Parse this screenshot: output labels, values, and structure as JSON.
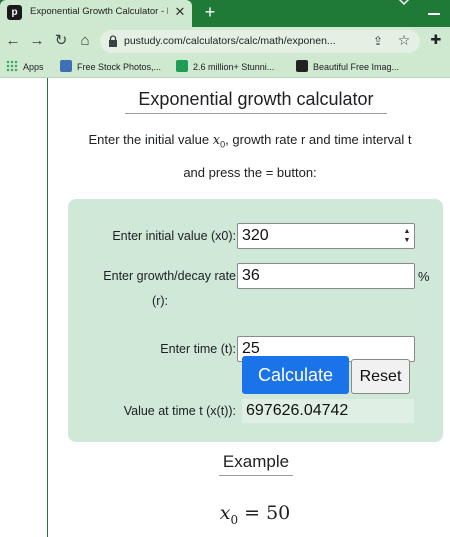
{
  "browser": {
    "tab_title": "Exponential Growth Calculator - F",
    "tab_favicon_letter": "p",
    "newtab_label": "+",
    "url": "pustudy.com/calculators/calc/math/exponen...",
    "bookmarks": [
      {
        "label": "Apps",
        "icon": "apps-grid-icon"
      },
      {
        "label": "Free Stock Photos,...",
        "icon": "photo-site-icon"
      },
      {
        "label": "2.6 million+ Stunni...",
        "icon": "px-site-icon"
      },
      {
        "label": "Beautiful Free Imag...",
        "icon": "image-site-icon"
      }
    ],
    "accent_color": "#1f7a38",
    "chrome_color": "#cfe8d0"
  },
  "page": {
    "title": "Exponential growth calculator",
    "intro_before": "Enter the initial value ",
    "intro_var": "x",
    "intro_sub": "0",
    "intro_after": ", growth rate r and time interval t",
    "intro_line2": "and press the = button:",
    "form": {
      "initial_label": "Enter initial value (x0):",
      "initial_value": "320",
      "rate_label": "Enter growth/decay rate",
      "rate_label2": "(r):",
      "rate_value": "36",
      "rate_unit": "%",
      "time_label": "Enter time (t):",
      "time_value": "25",
      "calculate_label": "Calculate",
      "reset_label": "Reset",
      "result_label": "Value at time t (x(t)):",
      "result_value": "697626.04742",
      "calculate_color": "#1a73e8",
      "panel_color": "#cfe8d8"
    },
    "example_heading": "Example",
    "example_formula_var": "x",
    "example_formula_sub": "0",
    "example_formula_rest": " = 50"
  }
}
